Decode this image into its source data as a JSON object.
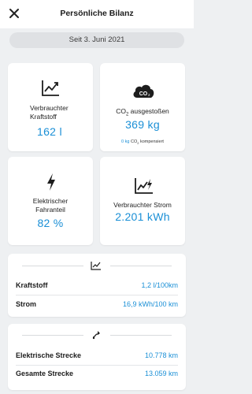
{
  "header": {
    "title": "Persönliche Bilanz",
    "close_icon": "close-icon"
  },
  "date_pill": {
    "text": "Seit 3. Juni 2021"
  },
  "cards": {
    "fuel": {
      "label_line1": "Verbrauchter",
      "label_line2": "Kraftstoff",
      "value": "162 l",
      "icon": "line-chart-icon"
    },
    "co2": {
      "icon_text": "CO",
      "icon_sub": "2",
      "label": "CO",
      "label_sub": "2",
      "label_rest": " ausgestoßen",
      "value": "369 kg",
      "comp_value": "0 kg",
      "comp_label": "CO",
      "comp_sub": "2",
      "comp_rest": " kompensiert",
      "icon": "co2-cloud-icon"
    },
    "electric": {
      "label_line1": "Elektrischer",
      "label_line2": "Fahranteil",
      "value": "82 %",
      "icon": "lightning-icon"
    },
    "power": {
      "label": "Verbrauchter Strom",
      "value": "2.201 kWh",
      "icon": "electric-chart-icon"
    }
  },
  "consumption": {
    "icon": "line-chart-icon",
    "rows": [
      {
        "label": "Kraftstoff",
        "value": "1,2 l/100km"
      },
      {
        "label": "Strom",
        "value": "16,9 kWh/100 km"
      }
    ]
  },
  "distance": {
    "icon": "route-icon",
    "rows": [
      {
        "label": "Elektrische Strecke",
        "value": "10.778 km"
      },
      {
        "label": "Gesamte Strecke",
        "value": "13.059 km"
      }
    ]
  },
  "colors": {
    "accent": "#1a8fd6",
    "background": "#eef0f2",
    "card": "#ffffff"
  }
}
